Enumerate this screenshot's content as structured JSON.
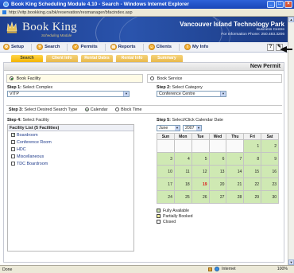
{
  "window": {
    "title": "Book King Scheduling Module 4.10 - Search - Windows Internet Explorer",
    "address": "http://vitp.bookking.ca/bk/reservation/resmanager/bfacindex.asp"
  },
  "banner": {
    "brand": "Book King",
    "brand_sub": "Scheduling Module",
    "org": "Vancouver Island Technology Park",
    "org_line1": "Business Centre",
    "org_line2": "For Information Phone: 250.483.3206"
  },
  "nav": {
    "items": [
      {
        "label": "Setup",
        "icon": "gear-icon"
      },
      {
        "label": "Search",
        "icon": "magnifier-icon"
      },
      {
        "label": "Permits",
        "icon": "permit-icon"
      },
      {
        "label": "Reports",
        "icon": "report-icon"
      },
      {
        "label": "Clients",
        "icon": "clients-icon"
      },
      {
        "label": "My Info",
        "icon": "info-icon"
      }
    ],
    "help": "?",
    "tool": "✎"
  },
  "tabs": [
    "Search",
    "Client Info",
    "Rental Dates",
    "Rental Info",
    "Summary"
  ],
  "page": {
    "title": "New Permit",
    "book_facility": "Book Facility",
    "book_service": "Book Service",
    "step1_label": "Step 1:",
    "step1_text": "Select Complex",
    "step1_value": "VITP",
    "step2_label": "Step 2:",
    "step2_text": "Select Category",
    "step2_value": "Conference Centre",
    "step3_label": "Step 3:",
    "step3_text": "Select Desired Search Type",
    "search_calendar": "Calendar",
    "search_blocktime": "Block Time",
    "step4_label": "Step 4:",
    "step4_text": "Select Facility",
    "facility_list_header": "Facility List (5 Facilities)",
    "facilities": [
      {
        "name": "Boardroom",
        "checked": true
      },
      {
        "name": "Conference Room",
        "checked": false
      },
      {
        "name": "HDC",
        "checked": false
      },
      {
        "name": "Miscellaneous",
        "checked": false
      },
      {
        "name": "TDC Boardroom",
        "checked": false
      }
    ],
    "step5_label": "Step 5:",
    "step5_text": "Select/Click Calendar Date",
    "month": "June",
    "year": "2007",
    "weekdays": [
      "Sun",
      "Mon",
      "Tue",
      "Wed",
      "Thu",
      "Fri",
      "Sat"
    ],
    "weeks": [
      [
        "",
        "",
        "",
        "",
        "",
        "1",
        "2"
      ],
      [
        "3",
        "4",
        "5",
        "6",
        "7",
        "8",
        "9"
      ],
      [
        "10",
        "11",
        "12",
        "13",
        "14",
        "15",
        "16"
      ],
      [
        "17",
        "18",
        "19",
        "20",
        "21",
        "22",
        "23"
      ],
      [
        "24",
        "25",
        "26",
        "27",
        "28",
        "29",
        "30"
      ]
    ],
    "today": "19",
    "legend": [
      "Fully Available",
      "Partially Booked",
      "Closed"
    ],
    "colors": {
      "available": "#cfe9b3",
      "partial": "#f4ef9c",
      "closed": "#ffffff"
    }
  },
  "status": {
    "left": "Done",
    "zone": "Internet",
    "zoom": "100%"
  }
}
